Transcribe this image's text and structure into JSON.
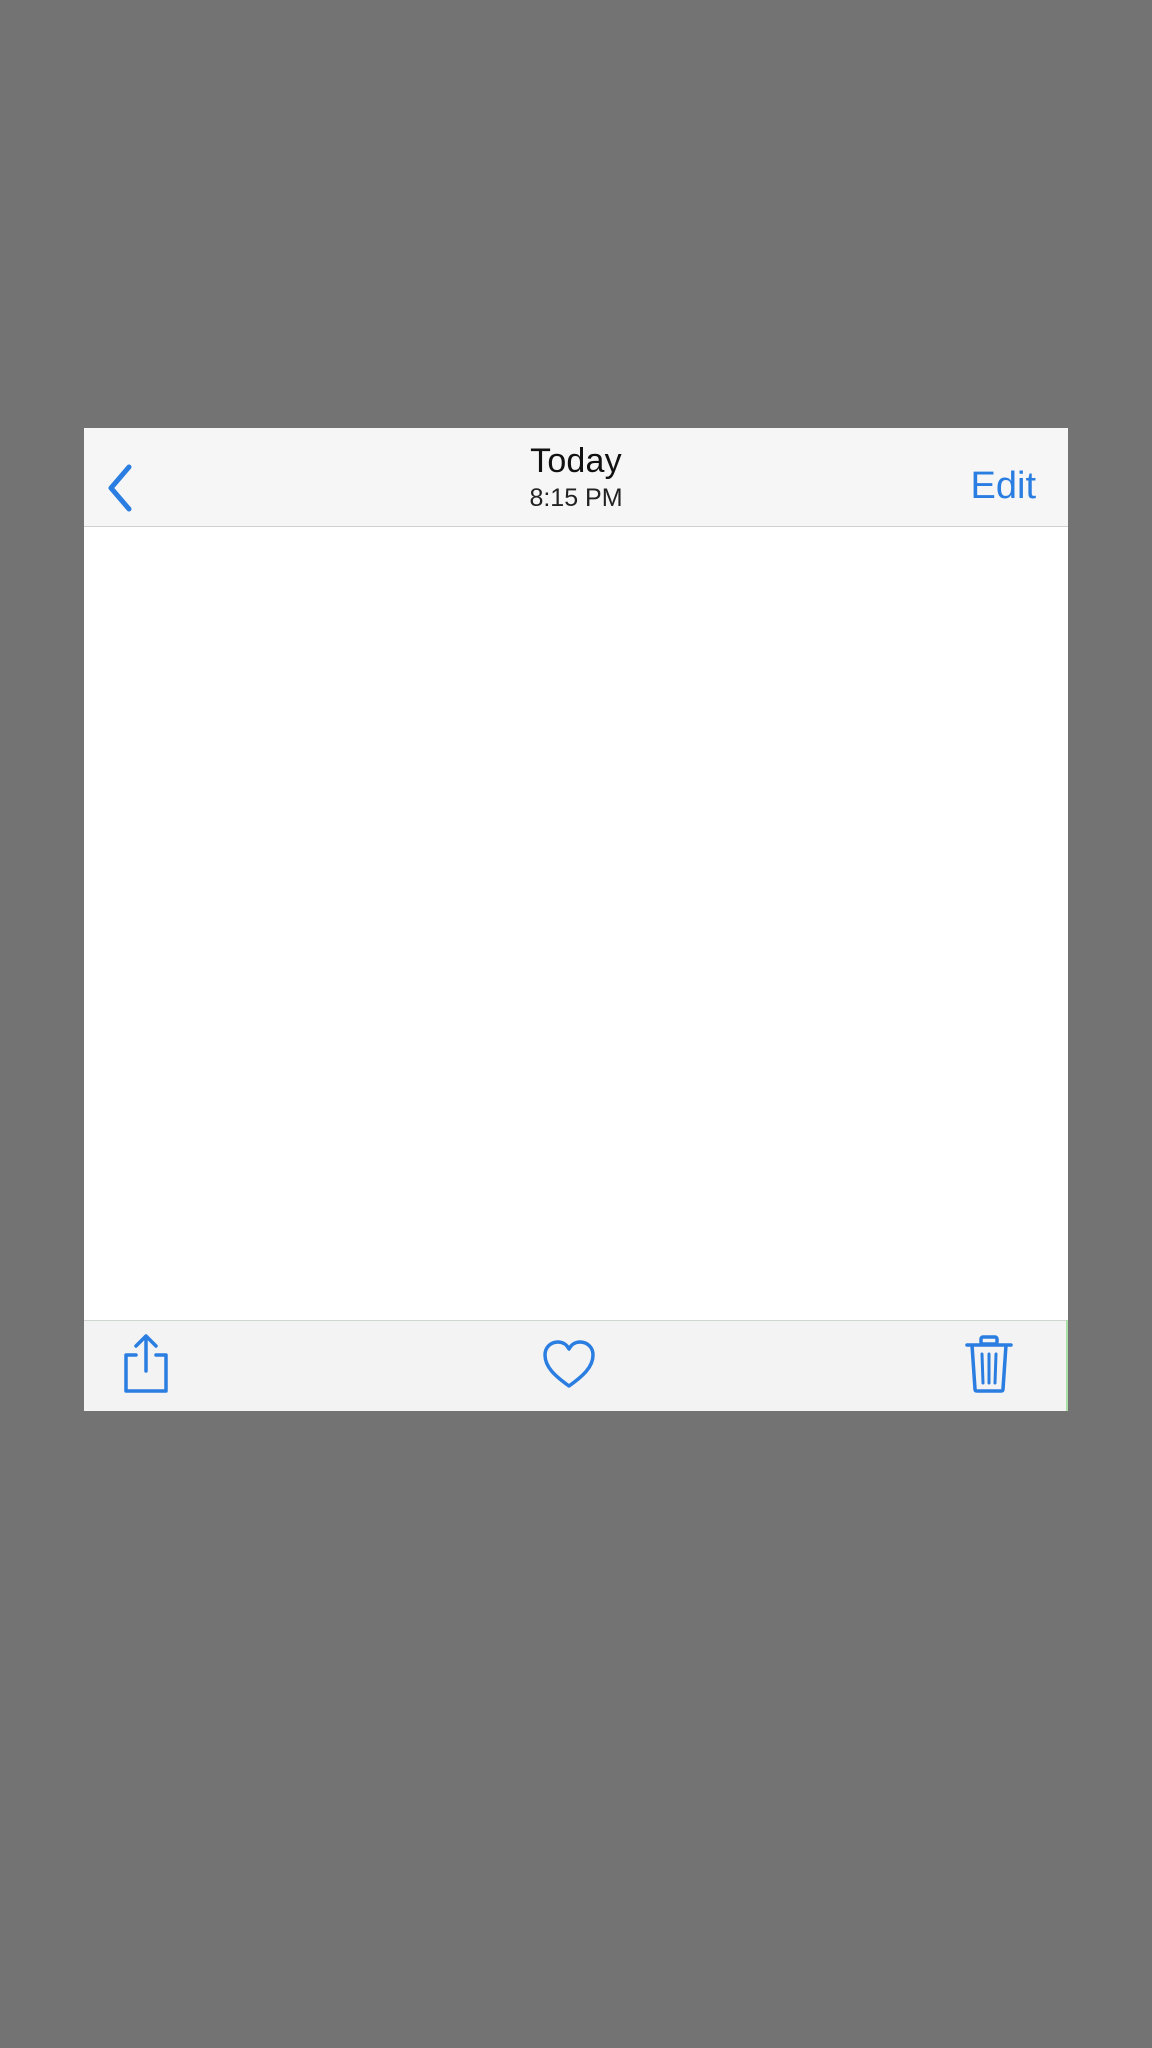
{
  "nav": {
    "title": "Today",
    "subtitle": "8:15 PM",
    "edit_label": "Edit",
    "back_icon": "chevron-left-icon"
  },
  "toolbar": {
    "share_icon": "share-icon",
    "favorite_icon": "heart-icon",
    "delete_icon": "trash-icon"
  },
  "colors": {
    "accent": "#2a7de1",
    "background": "#737373",
    "bar": "#f6f6f6"
  }
}
